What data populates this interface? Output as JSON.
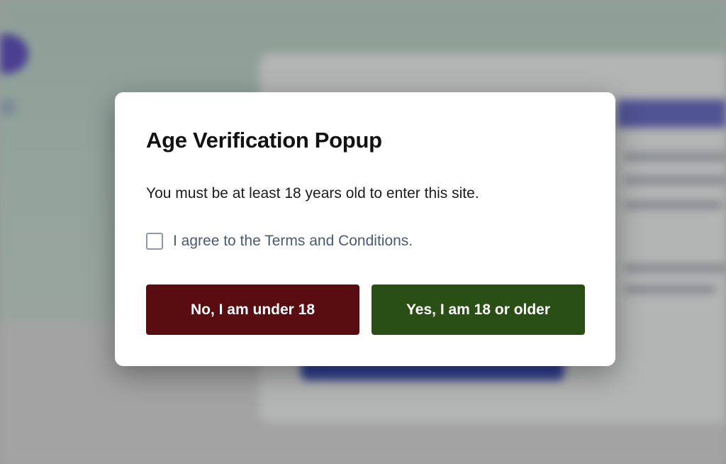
{
  "modal": {
    "title": "Age Verification Popup",
    "message": "You must be at least 18 years old to enter this site.",
    "checkbox": {
      "label": "I agree to the Terms and Conditions.",
      "checked": false
    },
    "buttons": {
      "no_label": "No, I am under 18",
      "yes_label": "Yes, I am 18 or older"
    }
  },
  "colors": {
    "no_button": "#5a0d10",
    "yes_button": "#2a4f14",
    "modal_background": "#ffffff",
    "overlay_blue_accent": "#4a3f91"
  }
}
